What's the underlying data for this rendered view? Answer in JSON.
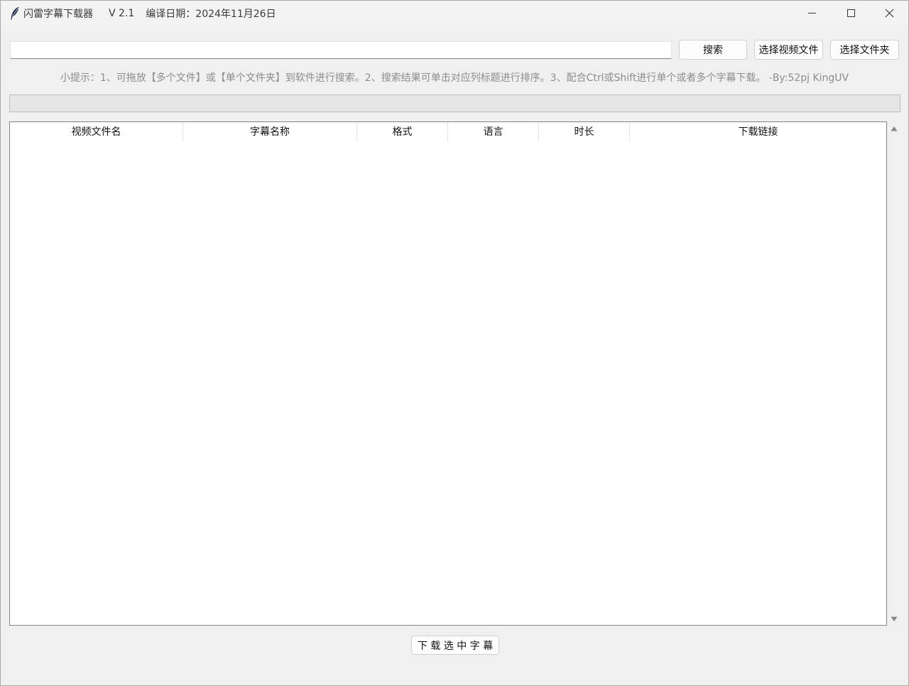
{
  "window": {
    "app_name": "闪雷字幕下载器",
    "version": "V 2.1",
    "build_date": "编译日期：2024年11月26日"
  },
  "icons": {
    "app": "feather-icon",
    "minimize": "minimize-icon",
    "maximize": "maximize-icon",
    "close": "close-icon",
    "scroll_up": "triangle-up-icon",
    "scroll_down": "triangle-down-icon"
  },
  "search": {
    "value": "",
    "placeholder": ""
  },
  "buttons": {
    "search": "搜索",
    "select_video": "选择视频文件",
    "select_folder": "选择文件夹",
    "download": "下 载 选 中 字 幕"
  },
  "hint": "小提示：1、可拖放【多个文件】或【单个文件夹】到软件进行搜索。2、搜索结果可单击对应列标题进行排序。3、配合Ctrl或Shift进行单个或者多个字幕下载。 -By:52pj KingUV",
  "progress": {
    "value": 0
  },
  "table": {
    "columns": [
      "视频文件名",
      "字幕名称",
      "格式",
      "语言",
      "时长",
      "下载链接"
    ],
    "rows": []
  },
  "colors": {
    "window_bg": "#f0f0f0",
    "titlebar_bg": "#f3f3f3",
    "hint_text": "#8c8c8c",
    "progress_track": "#e6e6e6",
    "table_bg": "#ffffff",
    "border": "#828282"
  }
}
